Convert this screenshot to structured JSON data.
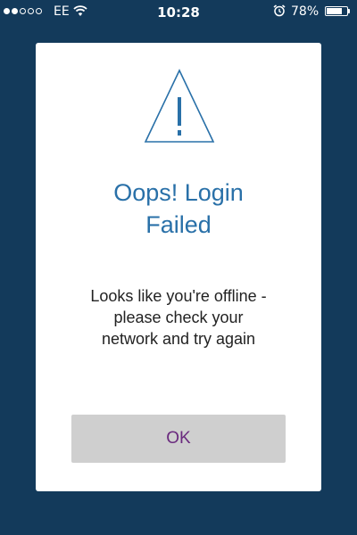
{
  "status_bar": {
    "signal_bars_filled": 2,
    "signal_bars_total": 5,
    "carrier": "EE",
    "wifi_icon": "wifi-icon",
    "time": "10:28",
    "alarm_icon": "alarm-clock-icon",
    "battery_percent": "78%",
    "battery_level": 0.78
  },
  "dialog": {
    "icon": "warning-triangle-icon",
    "title_line1": "Oops! Login",
    "title_line2": "Failed",
    "message_line1": "Looks like you're offline -",
    "message_line2": "please check your",
    "message_line3": "network and try again",
    "ok_label": "OK"
  },
  "colors": {
    "background": "#133a5b",
    "title": "#2970a8",
    "button_bg": "#cfcfcf",
    "button_text": "#6a2a7e"
  }
}
